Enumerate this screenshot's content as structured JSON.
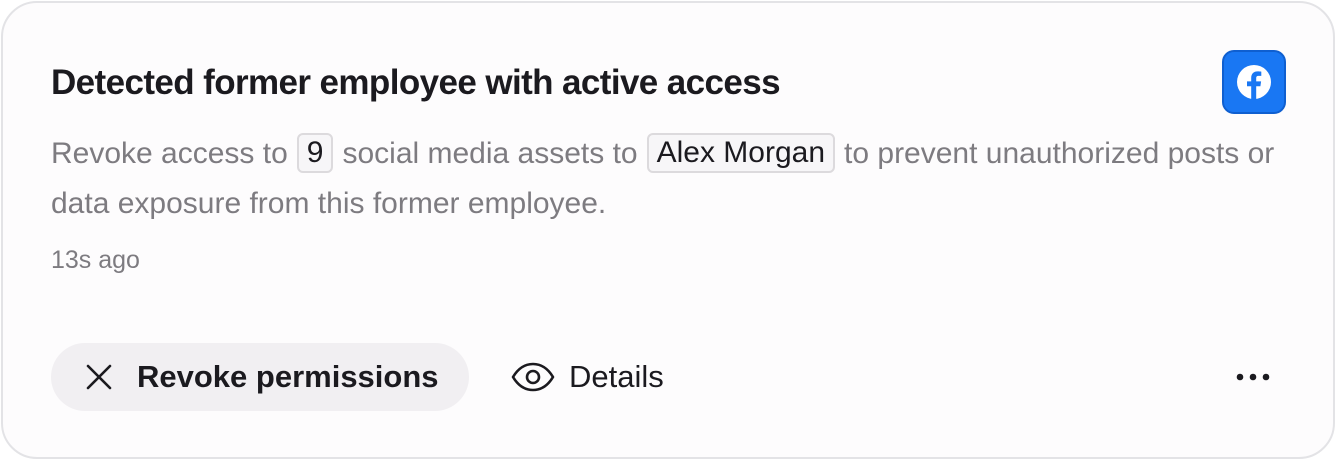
{
  "card": {
    "title": "Detected former employee with active access",
    "brand_icon": "facebook-icon",
    "brand_color": "#1977F3",
    "description": {
      "part1": "Revoke access to",
      "asset_count": "9",
      "part2": "social media assets to",
      "user_name": "Alex Morgan",
      "part3": "to prevent unauthorized posts or data exposure from this former employee."
    },
    "timestamp": "13s ago",
    "actions": {
      "revoke_label": "Revoke permissions",
      "revoke_icon": "close-icon",
      "details_label": "Details",
      "details_icon": "eye-icon",
      "more_icon": "more-horizontal-icon"
    }
  }
}
